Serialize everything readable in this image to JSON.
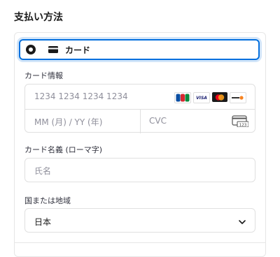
{
  "section_title": "支払い方法",
  "payment_method": {
    "label": "カード",
    "selected": true
  },
  "card_info": {
    "label": "カード情報",
    "number_placeholder": "1234 1234 1234 1234",
    "expiry_placeholder": "MM (月) / YY (年)",
    "cvc_placeholder": "CVC",
    "brands": [
      "JCB",
      "VISA",
      "Mastercard",
      "DISCOVER"
    ],
    "cvc_icon_text": "123"
  },
  "cardholder": {
    "label": "カード名義 (ローマ字)",
    "placeholder": "氏名"
  },
  "country": {
    "label": "国または地域",
    "value": "日本"
  },
  "colors": {
    "accent": "#0570de",
    "border": "#e0e0e0"
  }
}
